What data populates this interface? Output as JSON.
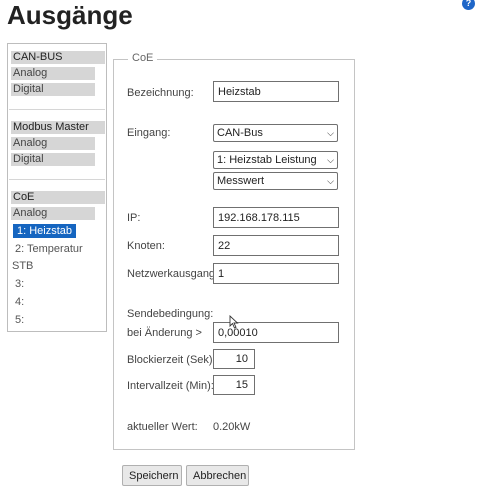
{
  "page": {
    "title": "Ausgänge",
    "help_icon": "help-icon"
  },
  "sidebar": {
    "groups": [
      {
        "header": "CAN-BUS",
        "items": [
          "Analog",
          "Digital"
        ]
      },
      {
        "header": "Modbus Master",
        "items": [
          "Analog",
          "Digital"
        ]
      },
      {
        "header": "CoE",
        "sub": "Analog",
        "entries": [
          "1: Heizstab",
          "2: Temperatur",
          "STB",
          "3:",
          "4:",
          "5:"
        ],
        "active_index": 0
      }
    ]
  },
  "form": {
    "legend": "CoE",
    "bezeichnung": {
      "label": "Bezeichnung:",
      "value": "Heizstab"
    },
    "eingang": {
      "label": "Eingang:",
      "select1": "CAN-Bus",
      "select2": "1: Heizstab Leistung",
      "select3": "Messwert"
    },
    "ip": {
      "label": "IP:",
      "value": "192.168.178.115"
    },
    "knoten": {
      "label": "Knoten:",
      "value": "22"
    },
    "netzwerkausgang": {
      "label": "Netzwerkausgang:",
      "value": "1"
    },
    "sendebedingung": {
      "label": "Sendebedingung:"
    },
    "aenderung": {
      "label": "bei Änderung >",
      "value": "0,00010"
    },
    "blockierzeit": {
      "label": "Blockierzeit (Sek):",
      "value": "10"
    },
    "intervallzeit": {
      "label": "Intervallzeit (Min):",
      "value": "15"
    },
    "aktueller_wert": {
      "label": "aktueller Wert:",
      "value": "0.20kW"
    }
  },
  "buttons": {
    "save": "Speichern",
    "cancel": "Abbrechen"
  }
}
